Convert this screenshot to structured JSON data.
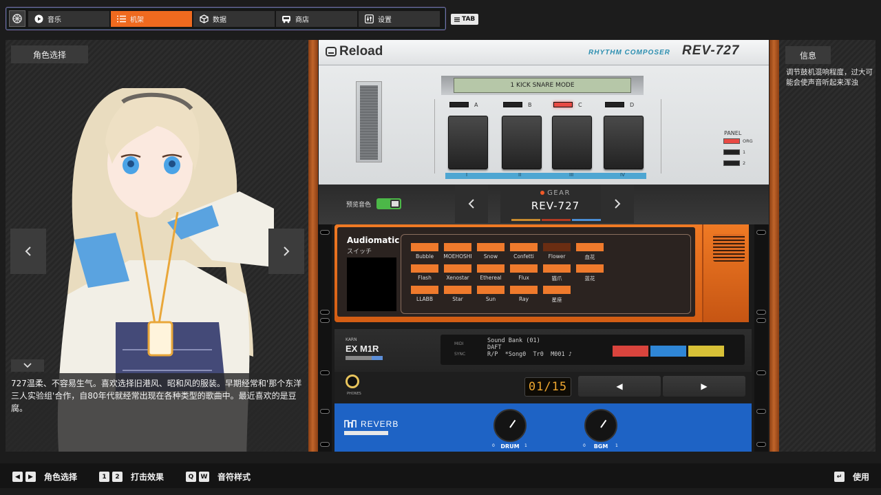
{
  "nav": {
    "tabs": [
      {
        "label": "音乐",
        "icon": "play-icon"
      },
      {
        "label": "机架",
        "icon": "list-icon"
      },
      {
        "label": "数据",
        "icon": "cube-icon"
      },
      {
        "label": "商店",
        "icon": "bus-icon"
      },
      {
        "label": "设置",
        "icon": "sliders-icon"
      }
    ],
    "active_tab": "机架",
    "tab_key": "TAB"
  },
  "left_panel": {
    "title": "角色选择",
    "description": "727温柔、不容易生气。喜欢选择旧港风、昭和风的服装。早期经常和'那个东洋三人实验组'合作，自80年代就经常出现在各种类型的歌曲中。最近喜欢的是豆腐。"
  },
  "right_panel": {
    "title": "信息",
    "text": "调节鼓机混响程度，过大可能会使声音听起来浑浊"
  },
  "drum_machine": {
    "brand": "Reload",
    "series": "RHYTHM COMPOSER",
    "model": "REV-727",
    "lcd": "1 KICK SNARE MODE",
    "pads": [
      {
        "label": "A",
        "lit": false,
        "numeral": "I"
      },
      {
        "label": "B",
        "lit": false,
        "numeral": "II"
      },
      {
        "label": "C",
        "lit": true,
        "numeral": "III"
      },
      {
        "label": "D",
        "lit": false,
        "numeral": "IV"
      }
    ],
    "panel_title": "PANEL",
    "panel_options": [
      {
        "label": "ORG",
        "on": true
      },
      {
        "label": "1",
        "on": false
      },
      {
        "label": "2",
        "on": false
      }
    ]
  },
  "gear": {
    "preview_label": "预览音色",
    "preview_on": true,
    "tag": "GEAR",
    "name": "REV-727",
    "stripe_colors": [
      "#c98b2e",
      "#b23a22",
      "#4a8ed6"
    ]
  },
  "audiomatic": {
    "title": "Audiomatic",
    "subtitle": "スイッチ",
    "presets": [
      {
        "label": "Bubble"
      },
      {
        "label": "MOEHOSHI"
      },
      {
        "label": "Snow"
      },
      {
        "label": "Confetti"
      },
      {
        "label": "Flower",
        "selected": true
      },
      {
        "label": "血花"
      },
      {
        "label": "Flash"
      },
      {
        "label": "Xenostar"
      },
      {
        "label": "Ethereal"
      },
      {
        "label": "Flux"
      },
      {
        "label": "猫爪"
      },
      {
        "label": "蓝花"
      },
      {
        "label": "LLABB"
      },
      {
        "label": "Star"
      },
      {
        "label": "Sun"
      },
      {
        "label": "Ray"
      },
      {
        "label": "星座"
      }
    ]
  },
  "exm1r": {
    "maker": "KARN",
    "model": "EX M1R",
    "midi_label": "MIDI",
    "sync_label": "SYNC",
    "lcd_line1": "Sound Bank (01)",
    "lcd_line2": "DAFT",
    "lcd_line3": "R/P  *Song0  Tr0  M001 ♪",
    "blocks": [
      "#d9443d",
      "#2f86d6",
      "#d8c137"
    ]
  },
  "transport": {
    "phones_label": "PHONES",
    "counter": "01/15",
    "prev_glyph": "◀",
    "next_glyph": "▶"
  },
  "reverb": {
    "title": "REVERB",
    "knobs": [
      {
        "label": "DRUM",
        "min": "0",
        "max": "1",
        "value": 0.6
      },
      {
        "label": "BGM",
        "min": "0",
        "max": "1",
        "value": 0.6
      }
    ]
  },
  "bottom": {
    "hints": [
      {
        "keys": [
          "◀",
          "▶"
        ],
        "label": "角色选择"
      },
      {
        "keys": [
          "1",
          "2"
        ],
        "label": "打击效果"
      },
      {
        "keys": [
          "Q",
          "W"
        ],
        "label": "音符样式"
      }
    ],
    "use_key": "↵",
    "use_label": "使用"
  }
}
